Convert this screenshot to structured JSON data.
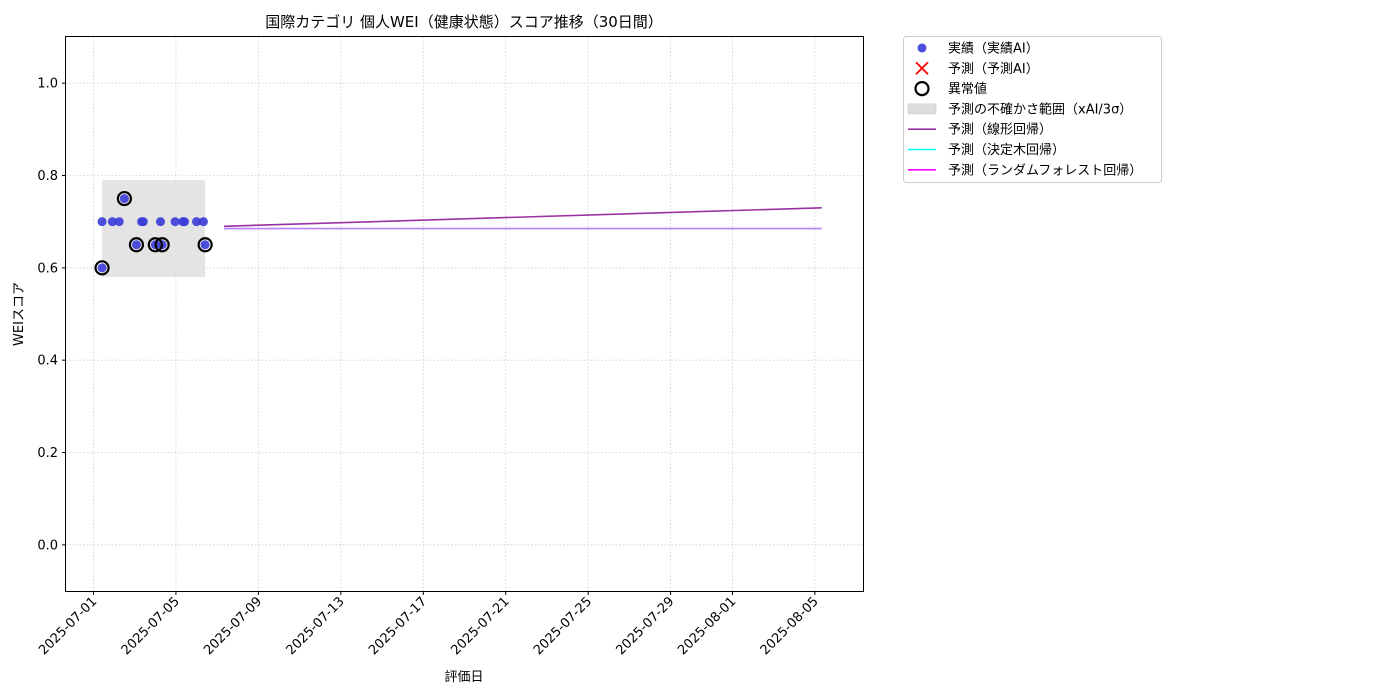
{
  "chart_data": {
    "type": "scatter",
    "title": "国際カテゴリ 個人WEI（健康状態）スコア推移（30日間）",
    "xlabel": "評価日",
    "ylabel": "WEIスコア",
    "xlim": [
      "2025-06-29T16:00",
      "2025-08-07T08:00"
    ],
    "ylim": [
      -0.1,
      1.1
    ],
    "yticks": [
      0.0,
      0.2,
      0.4,
      0.6,
      0.8,
      1.0
    ],
    "ytick_labels": [
      "0.0",
      "0.2",
      "0.4",
      "0.6",
      "0.8",
      "1.0"
    ],
    "xticks": [
      "2025-07-01",
      "2025-07-05",
      "2025-07-09",
      "2025-07-13",
      "2025-07-17",
      "2025-07-21",
      "2025-07-25",
      "2025-07-29",
      "2025-08-01",
      "2025-08-05"
    ],
    "xtick_labels": [
      "2025-07-01",
      "2025-07-05",
      "2025-07-09",
      "2025-07-13",
      "2025-07-17",
      "2025-07-21",
      "2025-07-25",
      "2025-07-29",
      "2025-08-01",
      "2025-08-05"
    ],
    "grid": true,
    "legend_position": "outside-right-top",
    "colors": {
      "actual": "#3b3bd9",
      "predicted": "#ff0000",
      "outlier": "#000000",
      "uncertainty": "#dddddd",
      "linear": "#9b30a0",
      "tree": "#00ffff",
      "forest": "#ff00ff",
      "overlap": "#8f7ff0"
    },
    "actual": [
      {
        "x": "2025-07-01T10:00",
        "y": 0.7
      },
      {
        "x": "2025-07-01T22:00",
        "y": 0.7
      },
      {
        "x": "2025-07-02T06:00",
        "y": 0.7
      },
      {
        "x": "2025-07-02T12:00",
        "y": 0.75
      },
      {
        "x": "2025-07-03T02:00",
        "y": 0.65
      },
      {
        "x": "2025-07-03T08:00",
        "y": 0.7
      },
      {
        "x": "2025-07-03T10:00",
        "y": 0.7
      },
      {
        "x": "2025-07-04T00:00",
        "y": 0.65
      },
      {
        "x": "2025-07-04T06:00",
        "y": 0.7
      },
      {
        "x": "2025-07-04T08:00",
        "y": 0.65
      },
      {
        "x": "2025-07-04T23:00",
        "y": 0.7
      },
      {
        "x": "2025-07-05T08:00",
        "y": 0.7
      },
      {
        "x": "2025-07-05T10:00",
        "y": 0.7
      },
      {
        "x": "2025-07-06T00:00",
        "y": 0.7
      },
      {
        "x": "2025-07-06T08:00",
        "y": 0.7
      },
      {
        "x": "2025-07-06T10:00",
        "y": 0.65
      },
      {
        "x": "2025-07-01T10:00",
        "y": 0.6
      }
    ],
    "outliers": [
      {
        "x": "2025-07-01T10:00",
        "y": 0.6
      },
      {
        "x": "2025-07-02T12:00",
        "y": 0.75
      },
      {
        "x": "2025-07-03T02:00",
        "y": 0.65
      },
      {
        "x": "2025-07-04T00:00",
        "y": 0.65
      },
      {
        "x": "2025-07-04T08:00",
        "y": 0.65
      },
      {
        "x": "2025-07-06T10:00",
        "y": 0.65
      }
    ],
    "uncertainty_band": {
      "x_start": "2025-07-01T10:00",
      "x_end": "2025-07-06T10:00",
      "y_low": 0.58,
      "y_high": 0.79
    },
    "series": [
      {
        "name": "予測（線形回帰）",
        "points": [
          {
            "x": "2025-07-07T08:00",
            "y": 0.69
          },
          {
            "x": "2025-08-05T08:00",
            "y": 0.73
          }
        ]
      },
      {
        "name": "予測（決定木回帰）",
        "points": [
          {
            "x": "2025-07-07T08:00",
            "y": 0.685
          },
          {
            "x": "2025-08-05T08:00",
            "y": 0.685
          }
        ]
      },
      {
        "name": "予測（ランダムフォレスト回帰）",
        "points": [
          {
            "x": "2025-07-07T08:00",
            "y": 0.685
          },
          {
            "x": "2025-08-05T08:00",
            "y": 0.685
          }
        ]
      }
    ],
    "legend": [
      {
        "key": "actual",
        "label": "実績（実績AI）"
      },
      {
        "key": "predicted",
        "label": "予測（予測AI）"
      },
      {
        "key": "outlier",
        "label": "異常値"
      },
      {
        "key": "uncertainty",
        "label": "予測の不確かさ範囲（xAI/3σ）"
      },
      {
        "key": "linear",
        "label": "予測（線形回帰）"
      },
      {
        "key": "tree",
        "label": "予測（決定木回帰）"
      },
      {
        "key": "forest",
        "label": "予測（ランダムフォレスト回帰）"
      }
    ]
  }
}
